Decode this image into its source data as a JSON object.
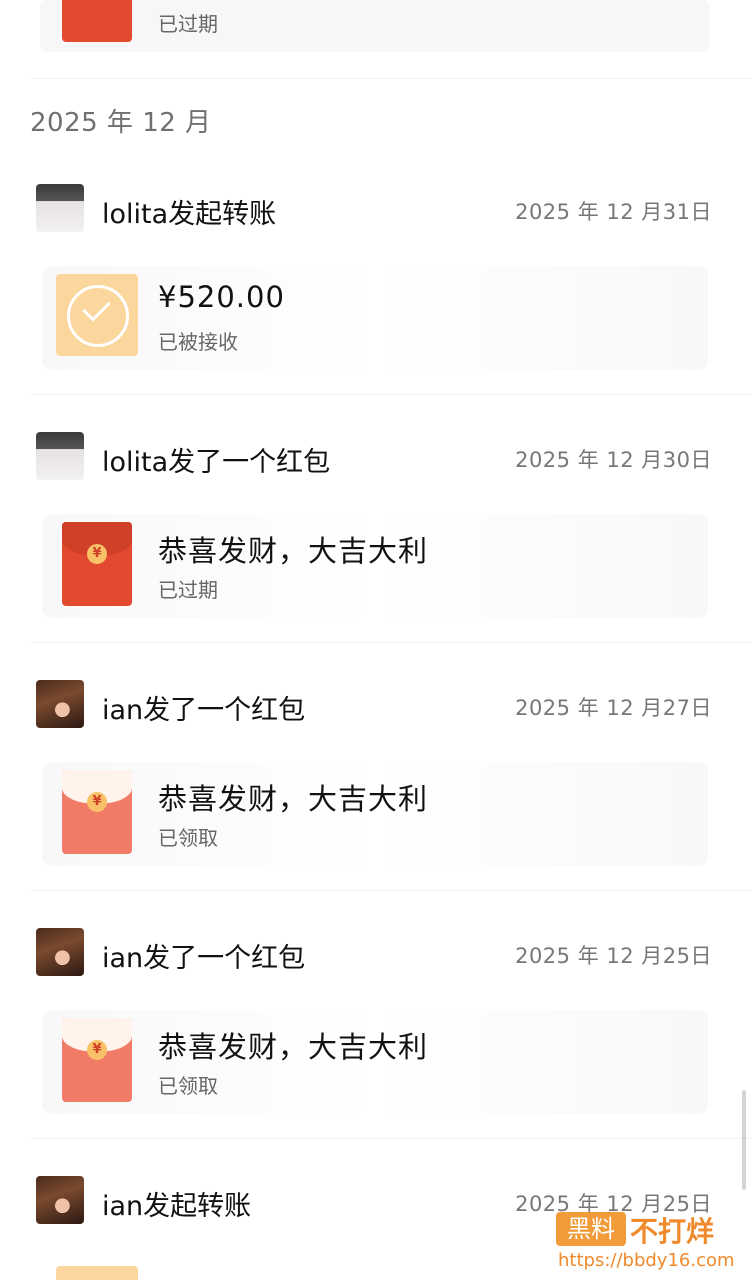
{
  "top_partial": {
    "status": "已过期"
  },
  "month_header": "2025 年 12 月",
  "entries": [
    {
      "sender": "lolita发起转账",
      "date": "2025 年 12 月31日",
      "title": "¥520.00",
      "status": "已被接收"
    },
    {
      "sender": "lolita发了一个红包",
      "date": "2025 年 12 月30日",
      "title": "恭喜发财，大吉大利",
      "status": "已过期"
    },
    {
      "sender": "ian发了一个红包",
      "date": "2025 年 12 月27日",
      "title": "恭喜发财，大吉大利",
      "status": "已领取"
    },
    {
      "sender": "ian发了一个红包",
      "date": "2025 年 12 月25日",
      "title": "恭喜发财，大吉大利",
      "status": "已领取"
    },
    {
      "sender": "ian发起转账",
      "date": "2025 年 12 月25日"
    }
  ],
  "yuan_symbol": "¥",
  "watermark": {
    "badge": "黑料",
    "text": "不打烊",
    "url": "https://bbdy16.com"
  }
}
